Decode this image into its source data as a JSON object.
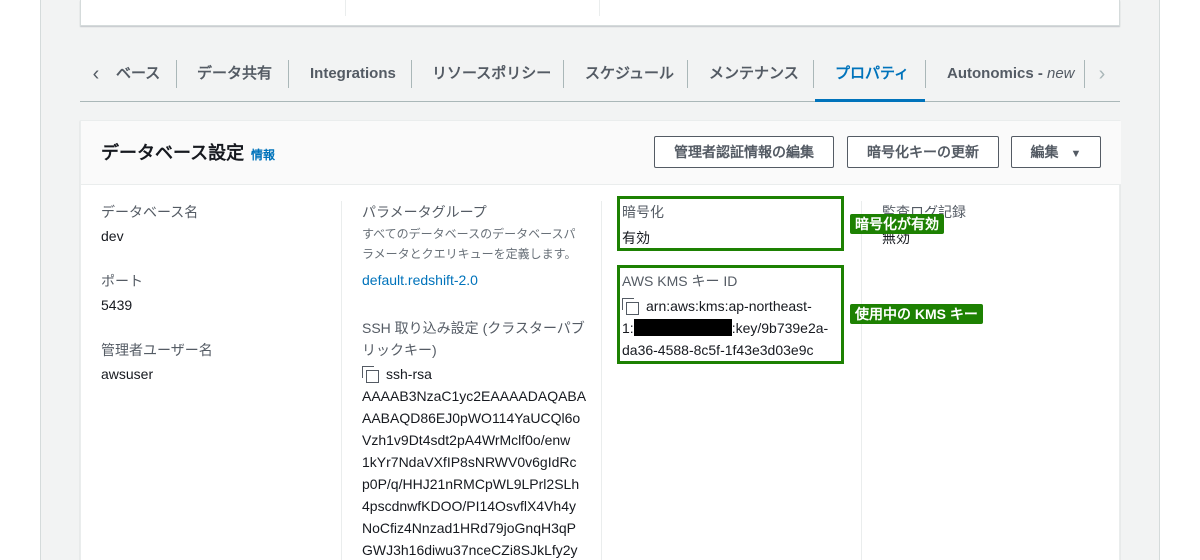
{
  "tabs": {
    "items": [
      {
        "label": "ベース"
      },
      {
        "label": "データ共有"
      },
      {
        "label": "Integrations"
      },
      {
        "label": "リソースポリシー"
      },
      {
        "label": "スケジュール"
      },
      {
        "label": "メンテナンス"
      },
      {
        "label": "プロパティ"
      },
      {
        "label": "Autonomics - ",
        "suffix": "new"
      }
    ],
    "active": "プロパティ",
    "prev_icon": "chevron-left-icon",
    "next_icon": "chevron-right-icon"
  },
  "panel": {
    "title": "データベース設定",
    "info_link": "情報",
    "buttons": {
      "edit_admin_credentials": "管理者認証情報の編集",
      "rotate_encryption_key": "暗号化キーの更新",
      "edit": "編集"
    }
  },
  "fields": {
    "db_name": {
      "label": "データベース名",
      "value": "dev"
    },
    "port": {
      "label": "ポート",
      "value": "5439"
    },
    "admin_user": {
      "label": "管理者ユーザー名",
      "value": "awsuser"
    },
    "parameter_group": {
      "label": "パラメータグループ",
      "desc_line1": "すべてのデータベースのデータベースパ",
      "desc_line2": "ラメータとクエリキューを定義します。",
      "value": "default.redshift-2.0"
    },
    "ssh": {
      "label_line1": "SSH 取り込み設定 (クラスターパブ",
      "label_line2": "リックキー)",
      "lines": [
        "ssh-rsa",
        "AAAAB3NzaC1yc2EAAAADAQABA",
        "AABAQD86EJ0pWO114YaUCQl6o",
        "Vzh1v9Dt4sdt2pA4WrMclf0o/enw",
        "1kYr7NdaVXfIP8sNRWV0v6gIdRc",
        "p0P/q/HHJ21nRMCpWL9LPrl2SLh",
        "4pscdnwfKDOO/PI14OsvflX4Vh4y",
        "NoCfiz4Nnzad1HRd79joGnqH3qP",
        "GWJ3h16diwu37nceCZi8SJkLfy2y"
      ]
    },
    "encryption": {
      "label": "暗号化",
      "value": "有効"
    },
    "kms_key": {
      "label": "AWS KMS キー ID",
      "line1": "arn:aws:kms:ap-northeast-",
      "line2_prefix": "1:",
      "line2_suffix": ":key/9b739e2a-",
      "line3": "da36-4588-8c5f-1f43e3d03e9c"
    },
    "audit_log": {
      "label": "監査ログ記録",
      "value": "無効"
    }
  },
  "annotations": {
    "encryption_enabled": "暗号化が有効",
    "kms_key_in_use": "使用中の KMS キー"
  },
  "colors": {
    "accent": "#0073bb",
    "highlight": "#1d8102"
  }
}
